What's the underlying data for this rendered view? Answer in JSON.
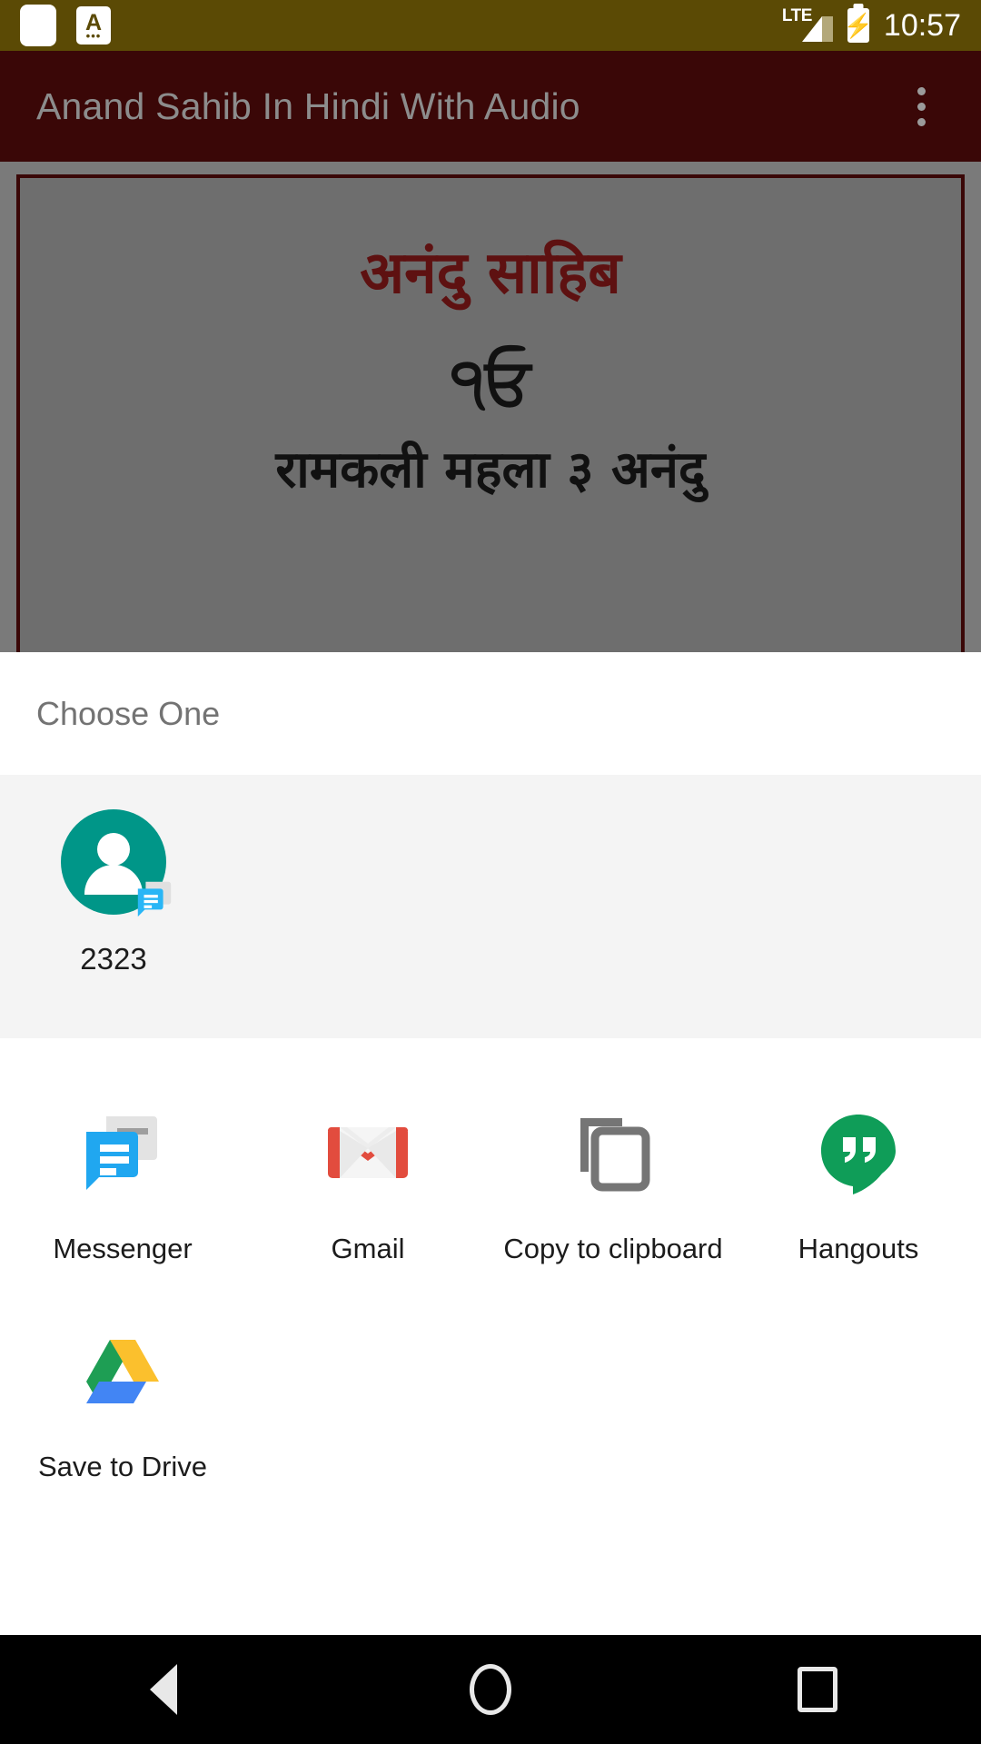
{
  "status_bar": {
    "icons": [
      "blank-notification-icon",
      "assist-a-icon"
    ],
    "network": "LTE",
    "battery": "charging",
    "time": "10:57",
    "background_color": "#5b4a05"
  },
  "app_bar": {
    "title": "Anand Sahib In Hindi With Audio",
    "overflow_label": "More options",
    "background_color": "#3a0707",
    "title_color": "#8c8c8c"
  },
  "content": {
    "title": "अनंदु साहिब",
    "ik_onkar": "੧ਓ",
    "subtitle": "रामकली महला ३ अनंदु",
    "title_color": "#5e1111",
    "background_color": "#6e6e6e",
    "border_color": "#3a0707"
  },
  "share_sheet": {
    "title": "Choose One",
    "direct_share": [
      {
        "label": "2323",
        "avatar_color": "#009688",
        "badge": "messenger-icon"
      }
    ],
    "apps": [
      {
        "label": "Messenger",
        "icon": "messenger-icon"
      },
      {
        "label": "Gmail",
        "icon": "gmail-icon"
      },
      {
        "label": "Copy to clipboard",
        "icon": "copy-icon"
      },
      {
        "label": "Hangouts",
        "icon": "hangouts-icon"
      },
      {
        "label": "Save to Drive",
        "icon": "google-drive-icon"
      }
    ]
  },
  "nav_bar": {
    "back": "Back",
    "home": "Home",
    "recents": "Recents"
  }
}
